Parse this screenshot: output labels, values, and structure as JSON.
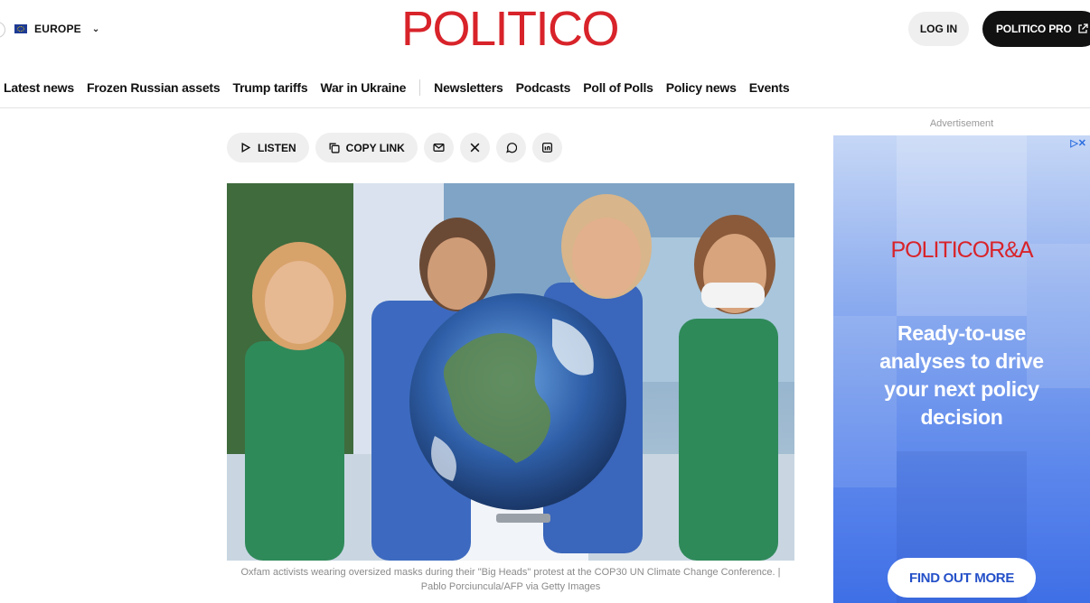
{
  "header": {
    "edition": "EUROPE",
    "logo": "POLITICO",
    "login": "LOG IN",
    "pro": "POLITICO PRO"
  },
  "nav": {
    "items": [
      "Latest news",
      "Frozen Russian assets",
      "Trump tariffs",
      "War in Ukraine"
    ],
    "secondary": [
      "Newsletters",
      "Podcasts",
      "Poll of Polls",
      "Policy news",
      "Events"
    ]
  },
  "share": {
    "listen": "LISTEN",
    "copy_link": "COPY LINK"
  },
  "article": {
    "caption": "Oxfam activists wearing oversized masks during their \"Big Heads\" protest at the COP30 UN Climate Change Conference. | Pablo Porciuncula/AFP via Getty Images"
  },
  "ad": {
    "label": "Advertisement",
    "logo_main": "POLITICO",
    "logo_suffix": "R&A",
    "copy": "Ready-to-use analyses to drive your next policy decision",
    "cta": "FIND OUT MORE"
  },
  "colors": {
    "brand_red": "#d8232a",
    "ad_blue": "#3f6fe6",
    "pill_gray": "#efefef"
  },
  "icons": [
    "eu-flag-icon",
    "chevron-down-icon",
    "external-link-icon",
    "play-icon",
    "copy-icon",
    "mail-icon",
    "x-icon",
    "whatsapp-icon",
    "linkedin-icon",
    "ad-choices-icon"
  ]
}
